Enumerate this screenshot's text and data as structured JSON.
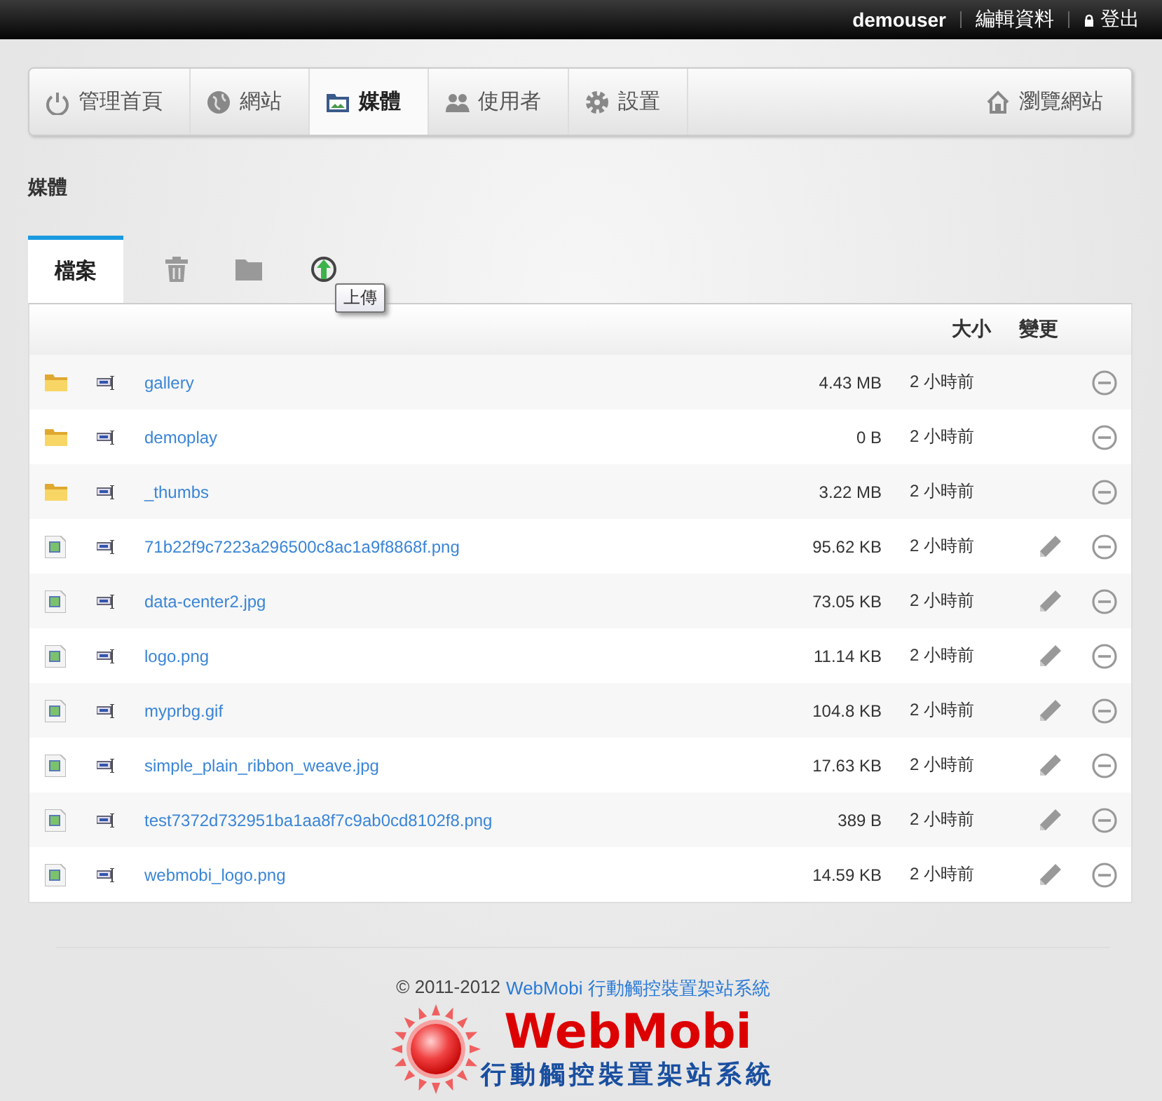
{
  "topbar": {
    "user": "demouser",
    "links": [
      {
        "label": "編輯資料",
        "kind": "plain"
      },
      {
        "label": "登出",
        "kind": "lock"
      }
    ]
  },
  "nav": {
    "items": [
      {
        "label": "管理首頁",
        "selected": false
      },
      {
        "label": "網站",
        "selected": false
      },
      {
        "label": "媒體",
        "selected": true
      },
      {
        "label": "使用者",
        "selected": false
      },
      {
        "label": "設置",
        "selected": false
      }
    ],
    "right": {
      "label": "瀏覽網站"
    }
  },
  "page_title": "媒體",
  "tabs": [
    {
      "label": "檔案",
      "selected": true
    }
  ],
  "toolbar": {
    "tooltip": "上傳"
  },
  "table": {
    "columns": [
      "大小",
      "變更"
    ],
    "rows": [
      {
        "kind": "folder",
        "name": "gallery",
        "size": "4.43 MB",
        "changed": "2 小時前",
        "editable": false
      },
      {
        "kind": "folder",
        "name": "demoplay",
        "size": "0 B",
        "changed": "2 小時前",
        "editable": false
      },
      {
        "kind": "folder",
        "name": "_thumbs",
        "size": "3.22 MB",
        "changed": "2 小時前",
        "editable": false
      },
      {
        "kind": "image",
        "name": "71b22f9c7223a296500c8ac1a9f8868f.png",
        "size": "95.62 KB",
        "changed": "2 小時前",
        "editable": true
      },
      {
        "kind": "image",
        "name": "data-center2.jpg",
        "size": "73.05 KB",
        "changed": "2 小時前",
        "editable": true
      },
      {
        "kind": "image",
        "name": "logo.png",
        "size": "11.14 KB",
        "changed": "2 小時前",
        "editable": true
      },
      {
        "kind": "image",
        "name": "myprbg.gif",
        "size": "104.8 KB",
        "changed": "2 小時前",
        "editable": true
      },
      {
        "kind": "image",
        "name": "simple_plain_ribbon_weave.jpg",
        "size": "17.63 KB",
        "changed": "2 小時前",
        "editable": true
      },
      {
        "kind": "image",
        "name": "test7372d732951ba1aa8f7c9ab0cd8102f8.png",
        "size": "389 B",
        "changed": "2 小時前",
        "editable": true
      },
      {
        "kind": "image",
        "name": "webmobi_logo.png",
        "size": "14.59 KB",
        "changed": "2 小時前",
        "editable": true
      }
    ]
  },
  "footer": {
    "copyright": "© 2011-2012",
    "link": "WebMobi 行動觸控裝置架站系統",
    "logo_title": "WebMobi",
    "logo_subtitle": "行動觸控裝置架站系統"
  }
}
